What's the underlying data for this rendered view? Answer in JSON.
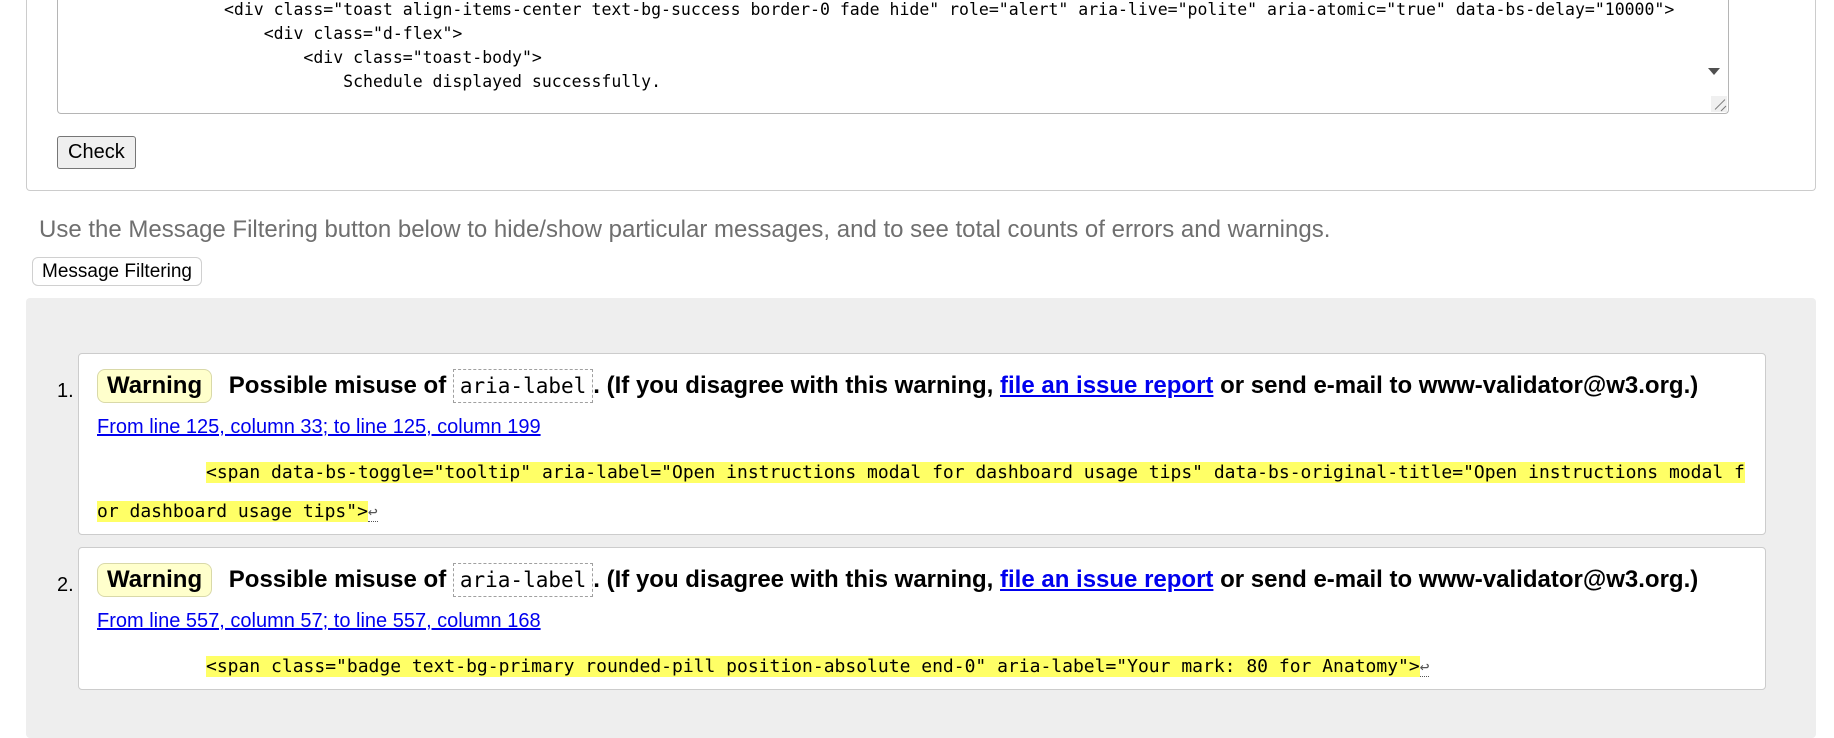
{
  "source_panel": {
    "code_text": "                <div class=\"toast align-items-center text-bg-success border-0 fade hide\" role=\"alert\" aria-live=\"polite\" aria-atomic=\"true\" data-bs-delay=\"10000\">\n                    <div class=\"d-flex\">\n                        <div class=\"toast-body\">\n                            Schedule displayed successfully.",
    "check_label": "Check"
  },
  "filter": {
    "hint": "Use the Message Filtering button below to hide/show particular messages, and to see total counts of errors and warnings.",
    "button_label": "Message Filtering"
  },
  "messages": [
    {
      "number": "1.",
      "type": "Warning",
      "prefix": "Possible misuse of",
      "attribute": "aria-label",
      "middle": ". (If you disagree with this warning,",
      "link_text": "file an issue report",
      "suffix": "or send e-mail to www-validator@w3.org.)",
      "location": "From line 125, column 33; to line 125, column 199",
      "extract": "<span data-bs-toggle=\"tooltip\" aria-label=\"Open instructions modal for dashboard usage tips\" data-bs-original-title=\"Open instructions modal for dashboard usage tips\">",
      "return_glyph": "↩"
    },
    {
      "number": "2.",
      "type": "Warning",
      "prefix": "Possible misuse of",
      "attribute": "aria-label",
      "middle": ". (If you disagree with this warning,",
      "link_text": "file an issue report",
      "suffix": "or send e-mail to www-validator@w3.org.)",
      "location": "From line 557, column 57; to line 557, column 168",
      "extract": "<span class=\"badge text-bg-primary rounded-pill position-absolute end-0\" aria-label=\"Your mark: 80 for Anatomy\">",
      "return_glyph": "↩"
    }
  ],
  "colors": {
    "link": "#0000ee",
    "highlight": "#ffff66",
    "warning_badge": "#ffffcc",
    "results_bg": "#eeeeee"
  }
}
